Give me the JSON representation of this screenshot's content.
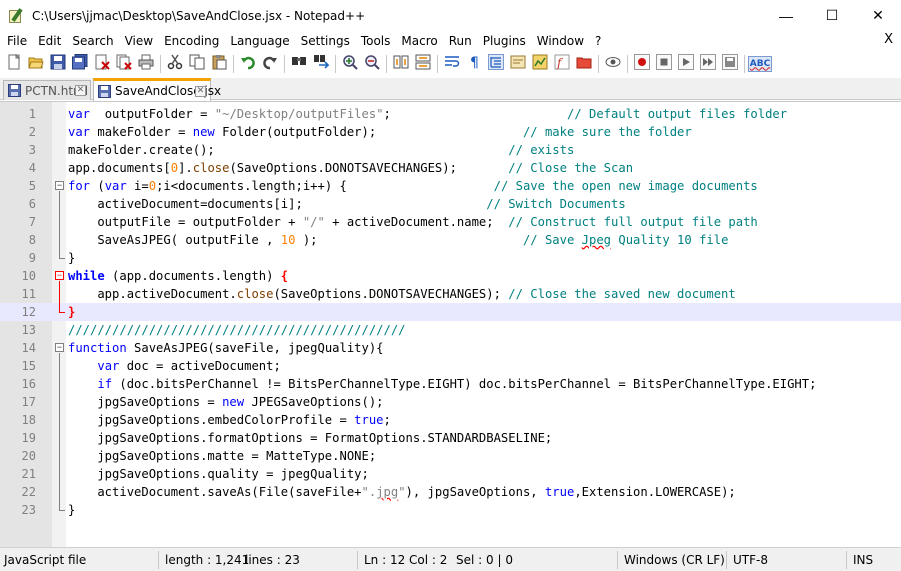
{
  "window": {
    "title": "C:\\Users\\jjmac\\Desktop\\SaveAndClose.jsx - Notepad++",
    "minimize": "—",
    "maximize": "☐",
    "close": "✕"
  },
  "menu": {
    "items": [
      "File",
      "Edit",
      "Search",
      "View",
      "Encoding",
      "Language",
      "Settings",
      "Tools",
      "Macro",
      "Run",
      "Plugins",
      "Window",
      "?"
    ],
    "close_x": "X"
  },
  "toolbar": {
    "icons": [
      "new-file-icon",
      "open-file-icon",
      "save-icon",
      "save-all-icon",
      "close-icon",
      "close-all-icon",
      "print-icon",
      "cut-icon",
      "copy-icon",
      "paste-icon",
      "undo-icon",
      "redo-icon",
      "find-icon",
      "replace-icon",
      "zoom-in-icon",
      "zoom-out-icon",
      "sync-vertical-icon",
      "sync-horizontal-icon",
      "word-wrap-icon",
      "show-all-characters-icon",
      "indent-guide-icon",
      "user-defined-language-icon",
      "document-map-icon",
      "function-list-icon",
      "folder-as-workspace-icon",
      "monitoring-icon",
      "record-macro-icon",
      "stop-macro-icon",
      "play-macro-icon",
      "run-macro-multiple-icon",
      "save-macro-icon",
      "spell-check-icon"
    ],
    "spell_label": "ABC"
  },
  "tabs": [
    {
      "label": "PCTN.html",
      "active": false
    },
    {
      "label": "SaveAndClose.jsx",
      "active": true
    }
  ],
  "editor": {
    "current_line": 12,
    "lines": [
      {
        "n": "1"
      },
      {
        "n": "2"
      },
      {
        "n": "3"
      },
      {
        "n": "4"
      },
      {
        "n": "5"
      },
      {
        "n": "6"
      },
      {
        "n": "7"
      },
      {
        "n": "8"
      },
      {
        "n": "9"
      },
      {
        "n": "10"
      },
      {
        "n": "11"
      },
      {
        "n": "12"
      },
      {
        "n": "13"
      },
      {
        "n": "14"
      },
      {
        "n": "15"
      },
      {
        "n": "16"
      },
      {
        "n": "17"
      },
      {
        "n": "18"
      },
      {
        "n": "19"
      },
      {
        "n": "20"
      },
      {
        "n": "21"
      },
      {
        "n": "22"
      },
      {
        "n": "23"
      }
    ],
    "code": [
      [
        [
          "kw",
          "var"
        ],
        [
          "",
          "  outputFolder = "
        ],
        [
          "str",
          "\"~/Desktop/outputFiles\""
        ],
        [
          "",
          ";"
        ],
        [
          "",
          "                        "
        ],
        [
          "com",
          "// Default output files folder"
        ]
      ],
      [
        [
          "kw",
          "var"
        ],
        [
          "",
          " makeFolder = "
        ],
        [
          "kw",
          "new"
        ],
        [
          "",
          " Folder(outputFolder);"
        ],
        [
          "",
          "                    "
        ],
        [
          "com",
          "// make sure the folder"
        ]
      ],
      [
        [
          "",
          "makeFolder.create();"
        ],
        [
          "",
          "                                        "
        ],
        [
          "com",
          "// exists"
        ]
      ],
      [
        [
          "",
          "app.documents["
        ],
        [
          "num",
          "0"
        ],
        [
          "",
          "]."
        ],
        [
          "meth",
          "close"
        ],
        [
          "",
          "(SaveOptions.DONOTSAVECHANGES);"
        ],
        [
          "",
          "       "
        ],
        [
          "com",
          "// Close the Scan"
        ]
      ],
      [
        [
          "kw",
          "for"
        ],
        [
          "",
          " ("
        ],
        [
          "kw",
          "var"
        ],
        [
          "",
          " i="
        ],
        [
          "num",
          "0"
        ],
        [
          "",
          ";i<documents.length;i++) {"
        ],
        [
          "",
          "                    "
        ],
        [
          "com",
          "// Save the open new image documents"
        ]
      ],
      [
        [
          "",
          "    activeDocument=documents[i];"
        ],
        [
          "",
          "                         "
        ],
        [
          "com",
          "// Switch Documents"
        ]
      ],
      [
        [
          "",
          "    outputFile = outputFolder + "
        ],
        [
          "str",
          "\"/\""
        ],
        [
          "",
          " + activeDocument.name;"
        ],
        [
          "",
          "  "
        ],
        [
          "com",
          "// Construct full output file path"
        ]
      ],
      [
        [
          "",
          "    SaveAsJPEG( outputFile , "
        ],
        [
          "num",
          "10"
        ],
        [
          "",
          " );"
        ],
        [
          "",
          "                            "
        ],
        [
          "com",
          "// Save "
        ],
        [
          "comw",
          "Jpeg"
        ],
        [
          "com",
          " Quality 10 file"
        ]
      ],
      [
        [
          "",
          "}"
        ]
      ],
      [
        [
          "kw2",
          "while"
        ],
        [
          "",
          " (app.documents.length) "
        ],
        [
          "redbr",
          "{"
        ]
      ],
      [
        [
          "",
          "    app.activeDocument."
        ],
        [
          "meth",
          "close"
        ],
        [
          "",
          "(SaveOptions.DONOTSAVECHANGES); "
        ],
        [
          "com",
          "// Close the saved new document"
        ]
      ],
      [
        [
          "redbr",
          "}"
        ]
      ],
      [
        [
          "com",
          "//////////////////////////////////////////////"
        ]
      ],
      [
        [
          "kw",
          "function"
        ],
        [
          "",
          " SaveAsJPEG(saveFile, jpegQuality){"
        ]
      ],
      [
        [
          "",
          "    "
        ],
        [
          "kw",
          "var"
        ],
        [
          "",
          " doc = activeDocument;"
        ]
      ],
      [
        [
          "",
          "    "
        ],
        [
          "kw",
          "if"
        ],
        [
          "",
          " (doc.bitsPerChannel != BitsPerChannelType.EIGHT) doc.bitsPerChannel = BitsPerChannelType.EIGHT;"
        ]
      ],
      [
        [
          "",
          "    jpgSaveOptions = "
        ],
        [
          "kw",
          "new"
        ],
        [
          "",
          " JPEGSaveOptions();"
        ]
      ],
      [
        [
          "",
          "    jpgSaveOptions.embedColorProfile = "
        ],
        [
          "kw",
          "true"
        ],
        [
          "",
          ";"
        ]
      ],
      [
        [
          "",
          "    jpgSaveOptions.formatOptions = FormatOptions.STANDARDBASELINE;"
        ]
      ],
      [
        [
          "",
          "    jpgSaveOptions.matte = MatteType.NONE;"
        ]
      ],
      [
        [
          "",
          "    jpgSaveOptions.quality = jpegQuality;"
        ]
      ],
      [
        [
          "",
          "    activeDocument.saveAs(File(saveFile+"
        ],
        [
          "str",
          "\"."
        ],
        [
          "strw",
          "jpg"
        ],
        [
          "str",
          "\""
        ],
        [
          "",
          "), jpgSaveOptions, "
        ],
        [
          "kw",
          "true"
        ],
        [
          "",
          ",Extension.LOWERCASE);"
        ]
      ],
      [
        [
          "",
          "}"
        ]
      ]
    ]
  },
  "status": {
    "file_type": "JavaScript file",
    "length": "length : 1,241",
    "lines": "lines : 23",
    "position": "Ln : 12",
    "col": "Col : 2",
    "sel": "Sel : 0 | 0",
    "eol": "Windows (CR LF)",
    "encoding": "UTF-8",
    "mode": "INS"
  }
}
